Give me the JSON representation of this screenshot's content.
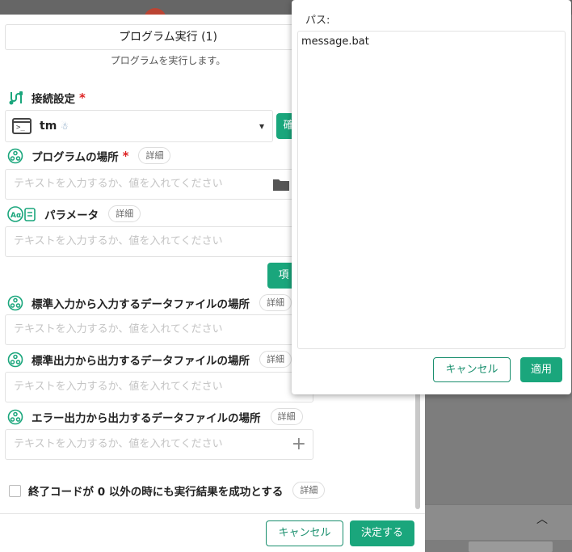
{
  "dialog": {
    "title": "プログラム実行 (1)",
    "subtitle": "プログラムを実行します。"
  },
  "connection": {
    "label": "接続設定",
    "required": "*",
    "value": "tm",
    "confirm_btn": "確"
  },
  "program_location": {
    "label": "プログラムの場所",
    "required": "*",
    "detail": "詳細",
    "placeholder": "テキストを入力するか、値を入れてください"
  },
  "parameters": {
    "label": "パラメータ",
    "detail": "詳細",
    "placeholder": "テキストを入力するか、値を入れてください",
    "add_item_btn": "項"
  },
  "stdin_file": {
    "label": "標準入力から入力するデータファイルの場所",
    "detail": "詳細",
    "placeholder": "テキストを入力するか、値を入れてください"
  },
  "stdout_file": {
    "label": "標準出力から出力するデータファイルの場所",
    "detail": "詳細",
    "placeholder": "テキストを入力するか、値を入れてください"
  },
  "stderr_file": {
    "label": "エラー出力から出力するデータファイルの場所",
    "detail": "詳細",
    "placeholder": "テキストを入力するか、値を入れてください"
  },
  "success_option": {
    "label": "終了コードが 0 以外の時にも実行結果を成功とする",
    "detail": "詳細"
  },
  "footer": {
    "cancel": "キャンセル",
    "submit": "決定する"
  },
  "path_popup": {
    "label": "パス:",
    "value": "message.bat",
    "cancel": "キャンセル",
    "apply": "適用"
  },
  "colors": {
    "accent": "#1aa67c",
    "required": "#d22222"
  }
}
